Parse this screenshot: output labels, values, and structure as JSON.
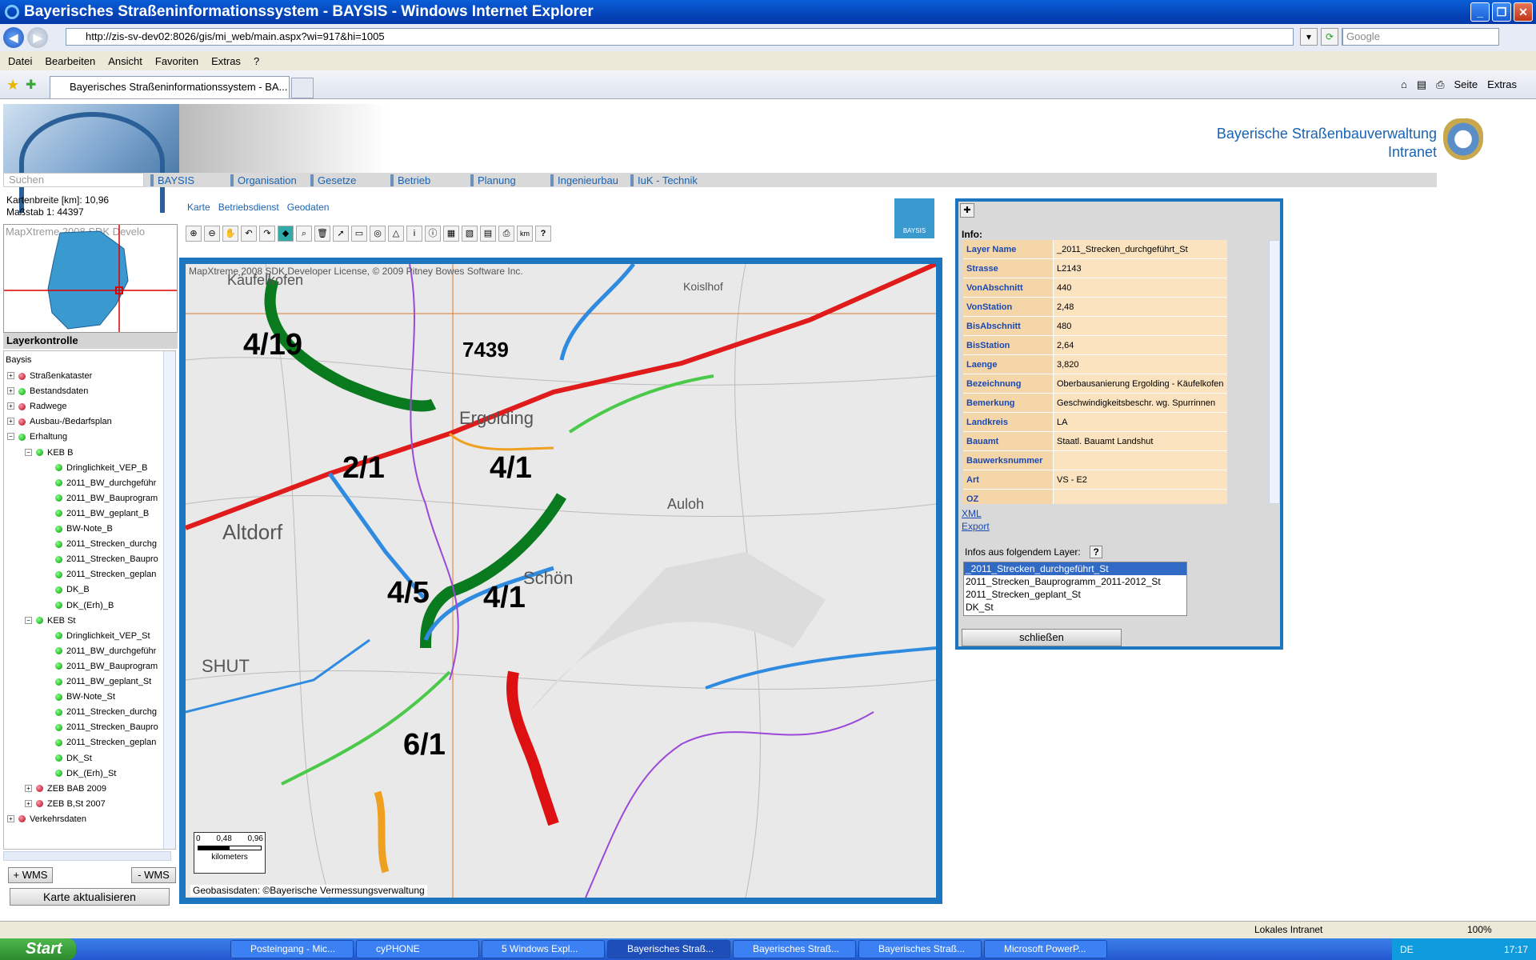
{
  "window": {
    "title": "Bayerisches Straßeninformationssystem - BAYSIS - Windows Internet Explorer"
  },
  "address": {
    "url": "http://zis-sv-dev02:8026/gis/mi_web/main.aspx?wi=917&hi=1005",
    "search_placeholder": "Google"
  },
  "menu": {
    "items": [
      "Datei",
      "Bearbeiten",
      "Ansicht",
      "Favoriten",
      "Extras",
      "?"
    ]
  },
  "tab": {
    "title": "Bayerisches Straßeninformationssystem - BA...",
    "tools": [
      "Seite",
      "Extras"
    ]
  },
  "header": {
    "org_line1": "Bayerische Straßenbauverwaltung",
    "org_line2": "Intranet"
  },
  "nav": {
    "search_placeholder": "Suchen",
    "links": [
      "BAYSIS",
      "Organisation",
      "Gesetze",
      "Betrieb",
      "Planung",
      "Ingenieurbau",
      "IuK - Technik"
    ]
  },
  "mapinfo": {
    "width": "Kartenbreite [km]: 10,96",
    "scale": "Maßstab 1: 44397",
    "overview_watermark": "MapXtreme 2008 SDK Develo"
  },
  "layerctrl": {
    "title": "Layerkontrolle",
    "root": "Baysis",
    "items": [
      {
        "label": "Straßenkataster",
        "color": "r",
        "level": 1,
        "exp": "+"
      },
      {
        "label": "Bestandsdaten",
        "color": "g",
        "level": 1,
        "exp": "+"
      },
      {
        "label": "Radwege",
        "color": "r",
        "level": 1,
        "exp": "+"
      },
      {
        "label": "Ausbau-/Bedarfsplan",
        "color": "r",
        "level": 1,
        "exp": "+"
      },
      {
        "label": "Erhaltung",
        "color": "g",
        "level": 1,
        "exp": "−"
      },
      {
        "label": "KEB B",
        "color": "g",
        "level": 2,
        "exp": "−"
      },
      {
        "label": "Dringlichkeit_VEP_B",
        "color": "g",
        "level": 3
      },
      {
        "label": "2011_BW_durchgeführ",
        "color": "g",
        "level": 3
      },
      {
        "label": "2011_BW_Bauprogram",
        "color": "g",
        "level": 3
      },
      {
        "label": "2011_BW_geplant_B",
        "color": "g",
        "level": 3
      },
      {
        "label": "BW-Note_B",
        "color": "g",
        "level": 3
      },
      {
        "label": "2011_Strecken_durchg",
        "color": "g",
        "level": 3
      },
      {
        "label": "2011_Strecken_Baupro",
        "color": "g",
        "level": 3
      },
      {
        "label": "2011_Strecken_geplan",
        "color": "g",
        "level": 3
      },
      {
        "label": "DK_B",
        "color": "g",
        "level": 3
      },
      {
        "label": "DK_(Erh)_B",
        "color": "g",
        "level": 3
      },
      {
        "label": "KEB St",
        "color": "g",
        "level": 2,
        "exp": "−"
      },
      {
        "label": "Dringlichkeit_VEP_St",
        "color": "g",
        "level": 3
      },
      {
        "label": "2011_BW_durchgeführ",
        "color": "g",
        "level": 3
      },
      {
        "label": "2011_BW_Bauprogram",
        "color": "g",
        "level": 3
      },
      {
        "label": "2011_BW_geplant_St",
        "color": "g",
        "level": 3
      },
      {
        "label": "BW-Note_St",
        "color": "g",
        "level": 3
      },
      {
        "label": "2011_Strecken_durchg",
        "color": "g",
        "level": 3
      },
      {
        "label": "2011_Strecken_Baupro",
        "color": "g",
        "level": 3
      },
      {
        "label": "2011_Strecken_geplan",
        "color": "g",
        "level": 3
      },
      {
        "label": "DK_St",
        "color": "g",
        "level": 3
      },
      {
        "label": "DK_(Erh)_St",
        "color": "g",
        "level": 3
      },
      {
        "label": "ZEB BAB 2009",
        "color": "r",
        "level": 2,
        "exp": "+"
      },
      {
        "label": "ZEB B,St 2007",
        "color": "r",
        "level": 2,
        "exp": "+"
      },
      {
        "label": "Verkehrsdaten",
        "color": "r",
        "level": 1,
        "exp": "+"
      }
    ],
    "add_wms": "+ WMS",
    "remove_wms": "- WMS",
    "refresh": "Karte aktualisieren"
  },
  "maptabs": [
    "Karte",
    "Betriebsdienst",
    "Geodaten"
  ],
  "map": {
    "copyright": "MapXtreme 2008 SDK Developer License, © 2009 Pitney Bowes Software Inc.",
    "geobasis": "Geobasisdaten: ©Bayerische Vermessungsverwaltung",
    "scale_ticks": [
      "0",
      "0,48",
      "0,96"
    ],
    "scale_unit": "kilometers",
    "logo": "BAYSIS",
    "big_labels": [
      "4/19",
      "7439",
      "2/1",
      "4/1",
      "4/5",
      "4/1",
      "6/1"
    ],
    "places": [
      "Altdorf",
      "Ergolding",
      "Schön",
      "SHUT",
      "Auloh",
      "Käufelkofen",
      "Koislhof"
    ]
  },
  "info": {
    "title": "Info:",
    "rows": [
      {
        "k": "Layer Name",
        "v": "_2011_Strecken_durchgeführt_St"
      },
      {
        "k": "Strasse",
        "v": "L2143"
      },
      {
        "k": "VonAbschnitt",
        "v": "440"
      },
      {
        "k": "VonStation",
        "v": "2,48"
      },
      {
        "k": "BisAbschnitt",
        "v": "480"
      },
      {
        "k": "BisStation",
        "v": "2,64"
      },
      {
        "k": "Laenge",
        "v": "3,820"
      },
      {
        "k": "Bezeichnung",
        "v": "Oberbausanierung Ergolding - Käufelkofen"
      },
      {
        "k": "Bemerkung",
        "v": "Geschwindigkeitsbeschr. wg. Spurrinnen"
      },
      {
        "k": "Landkreis",
        "v": "LA"
      },
      {
        "k": "Bauamt",
        "v": "Staatl. Bauamt Landshut"
      },
      {
        "k": "Bauwerksnummer",
        "v": ""
      },
      {
        "k": "Art",
        "v": "VS - E2"
      },
      {
        "k": "OZ",
        "v": ""
      }
    ],
    "link_xml": "XML",
    "link_export": "Export",
    "layers_label": "Infos aus folgendem Layer:",
    "layers": [
      "_2011_Strecken_durchgeführt_St",
      "2011_Strecken_Bauprogramm_2011-2012_St",
      "2011_Strecken_geplant_St",
      "DK_St"
    ],
    "close": "schließen"
  },
  "status": {
    "zone": "Lokales Intranet",
    "zoom": "100%"
  },
  "taskbar": {
    "start": "Start",
    "tasks": [
      "Posteingang - Mic...",
      "cyPHONE",
      "5 Windows Expl...",
      "Bayerisches Straß...",
      "Bayerisches Straß...",
      "Bayerisches Straß...",
      "Microsoft PowerP..."
    ],
    "lang": "DE",
    "time": "17:17"
  }
}
